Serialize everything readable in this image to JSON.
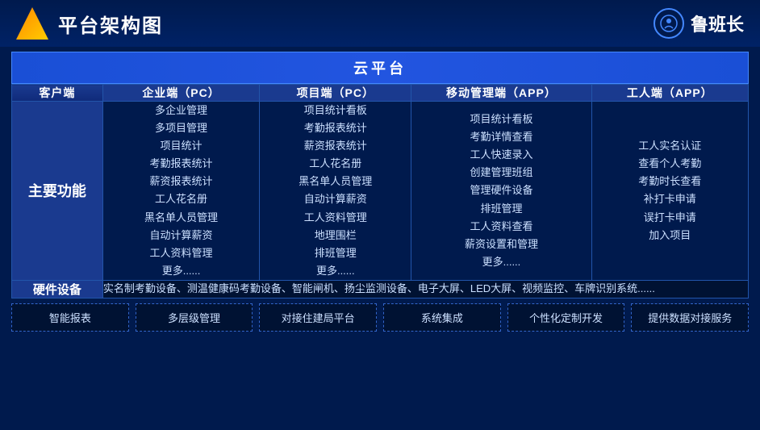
{
  "header": {
    "title": "平台架构图",
    "brand_name": "鲁班长"
  },
  "cloud_platform": {
    "label": "云平台"
  },
  "columns": {
    "client": "客户端",
    "enterprise": "企业端（PC）",
    "project": "项目端（PC）",
    "mobile": "移动管理端（APP）",
    "worker": "工人端（APP）"
  },
  "rows": {
    "main_features": {
      "label": "主要功能",
      "enterprise_features": "多企业管理\n多项目管理\n项目统计\n考勤报表统计\n薪资报表统计\n工人花名册\n黑名单人员管理\n自动计算薪资\n工人资料管理\n更多......",
      "project_features": "项目统计看板\n考勤报表统计\n薪资报表统计\n工人花名册\n黑名单人员管理\n自动计算薪资\n工人资料管理\n地理围栏\n排班管理\n更多......",
      "mobile_features": "项目统计看板\n考勤详情查看\n工人快速录入\n创建管理班组\n管理硬件设备\n排班管理\n工人资料查看\n薪资设置和管理\n更多......",
      "worker_features": "工人实名认证\n查看个人考勤\n考勤时长查看\n补打卡申请\n误打卡申请\n加入项目"
    },
    "hardware": {
      "label": "硬件设备",
      "content": "实名制考勤设备、测温健康码考勤设备、智能闸机、扬尘监测设备、电子大屏、LED大屏、视频监控、车牌识别系统......"
    }
  },
  "bottom_tags": [
    "智能报表",
    "多层级管理",
    "对接住建局平台",
    "系统集成",
    "个性化定制开发",
    "提供数据对接服务"
  ]
}
